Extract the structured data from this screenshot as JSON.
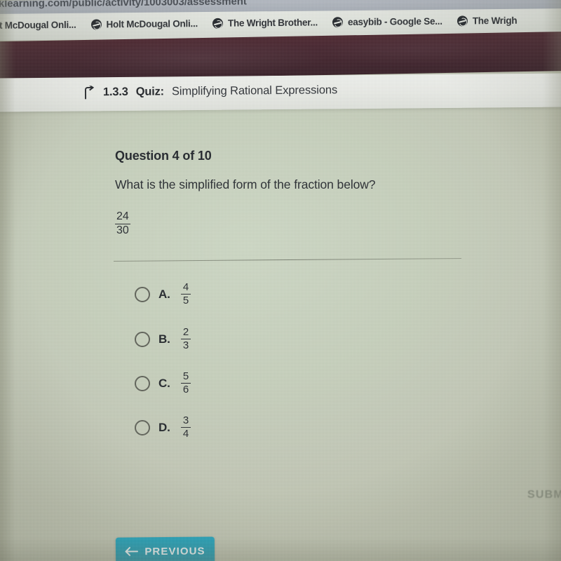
{
  "browser": {
    "url_text": "klearning.com/public/activity/1003003/assessment",
    "bookmarks": [
      {
        "label": "Holt McDougal Onli...",
        "icon": "globe-icon"
      },
      {
        "label": "Holt McDougal Onli...",
        "icon": "globe-icon"
      },
      {
        "label": "The Wright Brother...",
        "icon": "globe-icon"
      },
      {
        "label": "easybib - Google Se...",
        "icon": "globe-icon"
      },
      {
        "label": "The Wrigh",
        "icon": "globe-icon"
      }
    ]
  },
  "header": {
    "back_icon": "back-arrow-icon",
    "lesson_number": "1.3.3",
    "type_label": "Quiz:",
    "title": "Simplifying Rational Expressions"
  },
  "question": {
    "counter": "Question 4 of 10",
    "prompt": "What is the simplified form of the fraction below?",
    "stem_numerator": "24",
    "stem_denominator": "30",
    "options": [
      {
        "letter": "A.",
        "numerator": "4",
        "denominator": "5",
        "selected": false
      },
      {
        "letter": "B.",
        "numerator": "2",
        "denominator": "3",
        "selected": false
      },
      {
        "letter": "C.",
        "numerator": "5",
        "denominator": "6",
        "selected": false
      },
      {
        "letter": "D.",
        "numerator": "3",
        "denominator": "4",
        "selected": false
      }
    ]
  },
  "footer": {
    "previous_label": "PREVIOUS",
    "previous_icon": "arrow-left-icon",
    "submit_label": "SUBMIT"
  },
  "colors": {
    "page_background": "#c6cfbb",
    "dark_band": "#3e1f28",
    "previous_button": "#1d9cb4",
    "title_bar": "#e9ebe6",
    "text_primary": "#1d2126",
    "submit_ghost": "#7e8476"
  }
}
